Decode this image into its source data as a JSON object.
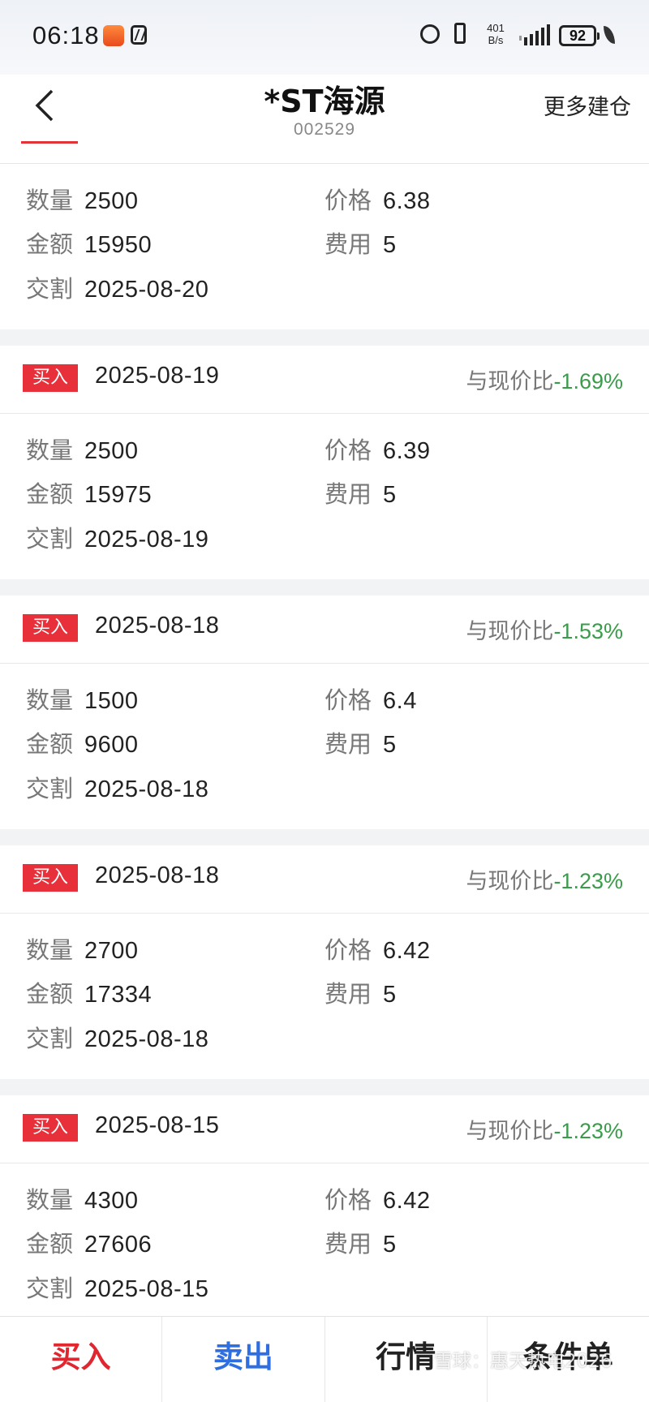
{
  "status_bar": {
    "time": "06:18",
    "net_speed_value": "401",
    "net_speed_unit": "B/s",
    "battery": "92"
  },
  "header": {
    "stock_name": "*ST海源",
    "stock_code": "002529",
    "more_label": "更多建仓"
  },
  "labels": {
    "quantity": "数量",
    "amount": "金额",
    "delivery": "交割",
    "price": "价格",
    "fee": "费用",
    "compare": "与现价比",
    "buy_tag": "买入"
  },
  "records": [
    {
      "quantity": "2500",
      "amount": "15950",
      "delivery": "2025-08-20",
      "price": "6.38",
      "fee": "5"
    },
    {
      "date": "2025-08-19",
      "compare": "-1.69%",
      "quantity": "2500",
      "amount": "15975",
      "delivery": "2025-08-19",
      "price": "6.39",
      "fee": "5"
    },
    {
      "date": "2025-08-18",
      "compare": "-1.53%",
      "quantity": "1500",
      "amount": "9600",
      "delivery": "2025-08-18",
      "price": "6.4",
      "fee": "5"
    },
    {
      "date": "2025-08-18",
      "compare": "-1.23%",
      "quantity": "2700",
      "amount": "17334",
      "delivery": "2025-08-18",
      "price": "6.42",
      "fee": "5"
    },
    {
      "date": "2025-08-15",
      "compare": "-1.23%",
      "quantity": "4300",
      "amount": "27606",
      "delivery": "2025-08-15",
      "price": "6.42",
      "fee": "5"
    }
  ],
  "bottom_bar": {
    "buy": "买入",
    "sell": "卖出",
    "quote": "行情",
    "conditional": "条件单"
  },
  "watermark": "雪球：惠天热电2026",
  "colors": {
    "accent_red": "#e8303a",
    "sell_blue": "#2f6ee0",
    "down_green": "#3a9c4a"
  }
}
